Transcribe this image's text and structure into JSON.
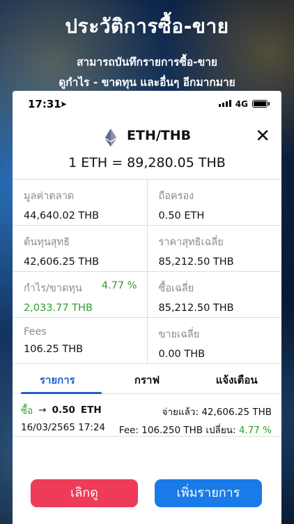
{
  "promo": {
    "title": "ประวัติการซื้อ-ขาย",
    "line1": "สามารถบันทึกรายการซื้อ-ขาย",
    "line2": "ดูกำไร - ขาดทุน และอื่นๆ อีกมากมาย"
  },
  "status_bar": {
    "time": "17:31",
    "network": "4G"
  },
  "header": {
    "pair": "ETH/THB",
    "close_icon": "close-icon",
    "coin_icon": "ethereum-icon"
  },
  "rate": "1 ETH = 89,280.05 THB",
  "stats": {
    "market_value": {
      "label": "มูลค่าตลาด",
      "value": "44,640.02 THB"
    },
    "holding": {
      "label": "ถือครอง",
      "value": "0.50 ETH"
    },
    "net_cost": {
      "label": "ต้นทุนสุทธิ",
      "value": "42,606.25 THB"
    },
    "avg_net_price": {
      "label": "ราคาสุทธิเฉลี่ย",
      "value": "85,212.50 THB"
    },
    "profit_loss": {
      "label": "กำไร/ขาดทุน",
      "percent": "4.77 %",
      "value": "2,033.77 THB"
    },
    "avg_buy": {
      "label": "ซื้อเฉลี่ย",
      "value": "85,212.50 THB"
    },
    "fees": {
      "label": "Fees",
      "value": "106.25 THB"
    },
    "avg_sell": {
      "label": "ขายเฉลี่ย",
      "value": "0.00 THB"
    }
  },
  "tabs": [
    {
      "label": "รายการ"
    },
    {
      "label": "กราฟ"
    },
    {
      "label": "แจ้งเตือน"
    }
  ],
  "transaction": {
    "side": "ซื้อ",
    "arrow": "→",
    "amount": "0.50",
    "unit": "ETH",
    "paid": "จ่ายแล้ว: 42,606.25 THB",
    "date": "16/03/2565 17:24",
    "fee": "Fee: 106.250 THB",
    "change_label": "เปลี่ยน:",
    "change_value": "4.77 %"
  },
  "buttons": {
    "cancel": "เลิกดู",
    "add": "เพิ่มรายการ"
  },
  "colors": {
    "accent": "#1f5fcf",
    "gain": "#2e9d2e",
    "cancel": "#ee3b59",
    "add": "#1a7ae8"
  }
}
